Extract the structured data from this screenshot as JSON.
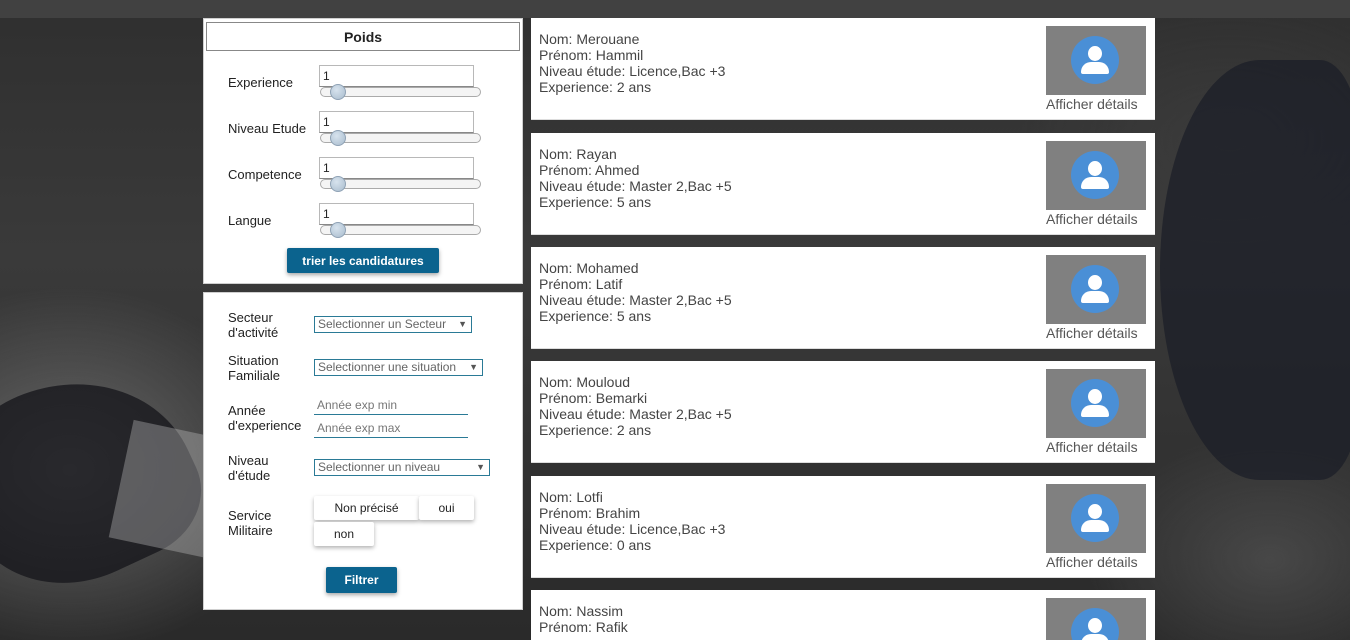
{
  "weights": {
    "title": "Poids",
    "fields": [
      {
        "label": "Experience",
        "value": "1"
      },
      {
        "label": "Niveau Etude",
        "value": "1"
      },
      {
        "label": "Competence",
        "value": "1"
      },
      {
        "label": "Langue",
        "value": "1"
      }
    ],
    "sort_button": "trier les candidatures"
  },
  "filters": {
    "sector": {
      "label1": "Secteur",
      "label2": "d'activité",
      "selected": "Selectionner un Secteur"
    },
    "family": {
      "label1": "Situation",
      "label2": "Familiale",
      "selected": "Selectionner une situation"
    },
    "experience": {
      "label1": "Année",
      "label2": "d'experience",
      "min_placeholder": "Année exp min",
      "max_placeholder": "Année exp max"
    },
    "level": {
      "label1": "Niveau",
      "label2": "d'étude",
      "selected": "Selectionner un niveau"
    },
    "military": {
      "label1": "Service",
      "label2": "Militaire",
      "options": [
        "Non précisé",
        "oui",
        "non"
      ]
    },
    "filter_button": "Filtrer"
  },
  "candidates": [
    {
      "nom": "Nom: Merouane",
      "prenom": "Prénom: Hammil",
      "niveau": "Niveau étude: Licence,Bac +3",
      "experience": "Experience: 2 ans",
      "link": "Afficher détails"
    },
    {
      "nom": "Nom: Rayan",
      "prenom": "Prénom: Ahmed",
      "niveau": "Niveau étude: Master 2,Bac +5",
      "experience": "Experience: 5 ans",
      "link": "Afficher détails"
    },
    {
      "nom": "Nom: Mohamed",
      "prenom": "Prénom: Latif",
      "niveau": "Niveau étude: Master 2,Bac +5",
      "experience": "Experience: 5 ans",
      "link": "Afficher détails"
    },
    {
      "nom": "Nom: Mouloud",
      "prenom": "Prénom: Bemarki",
      "niveau": "Niveau étude: Master 2,Bac +5",
      "experience": "Experience: 2 ans",
      "link": "Afficher détails"
    },
    {
      "nom": "Nom: Lotfi",
      "prenom": "Prénom: Brahim",
      "niveau": "Niveau étude: Licence,Bac +3",
      "experience": "Experience: 0 ans",
      "link": "Afficher détails"
    },
    {
      "nom": "Nom: Nassim",
      "prenom": "Prénom: Rafik",
      "niveau": "",
      "experience": "",
      "link": ""
    }
  ],
  "colors": {
    "primary_button": "#0b638e",
    "avatar_bg": "#808080",
    "avatar_circle": "#4a8fd6",
    "input_border": "#2a7a96"
  }
}
